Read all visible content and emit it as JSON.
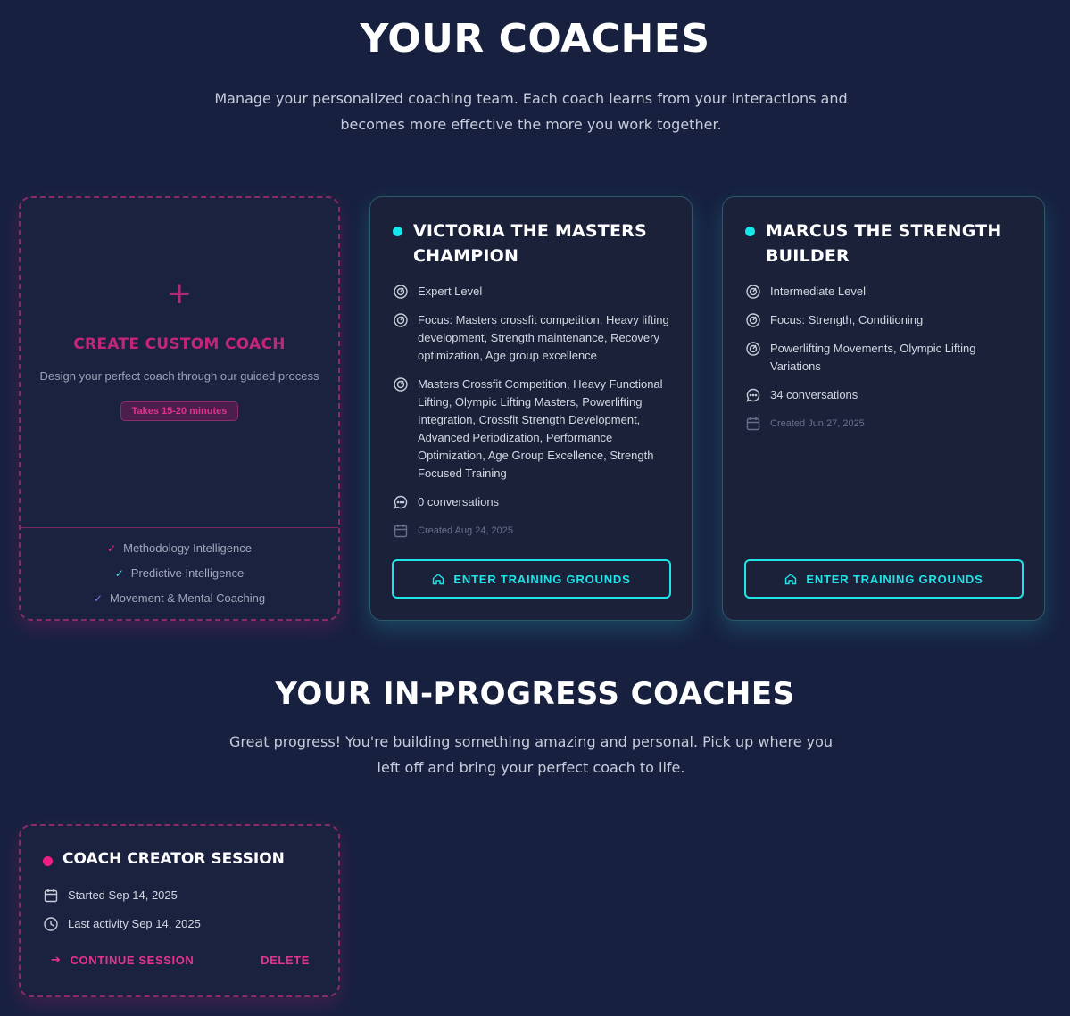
{
  "header": {
    "title": "YOUR COACHES",
    "subtitle": "Manage your personalized coaching team. Each coach learns from your interactions and becomes more effective the more you work together."
  },
  "create_card": {
    "icon": "plus-icon",
    "title": "CREATE CUSTOM COACH",
    "description": "Design your perfect coach through our guided process",
    "pill": "Takes 15-20 minutes",
    "features": [
      {
        "label": "Methodology Intelligence",
        "check_color": "#e0338f"
      },
      {
        "label": "Predictive Intelligence",
        "check_color": "#2ee6e6"
      },
      {
        "label": "Movement & Mental Coaching",
        "check_color": "#8a6cf0"
      }
    ]
  },
  "coaches": [
    {
      "name": "VICTORIA THE MASTERS CHAMPION",
      "level": "Expert Level",
      "focus": "Focus: Masters crossfit competition, Heavy lifting development, Strength maintenance, Recovery optimization, Age group excellence",
      "specialties": "Masters Crossfit Competition, Heavy Functional Lifting, Olympic Lifting Masters, Powerlifting Integration, Crossfit Strength Development, Advanced Periodization, Performance Optimization, Age Group Excellence, Strength Focused Training",
      "conversations": "0 conversations",
      "created": "Created Aug 24, 2025",
      "button": "ENTER TRAINING GROUNDS"
    },
    {
      "name": "MARCUS THE STRENGTH BUILDER",
      "level": "Intermediate Level",
      "focus": "Focus: Strength, Conditioning",
      "specialties": "Powerlifting Movements, Olympic Lifting Variations",
      "conversations": "34 conversations",
      "created": "Created Jun 27, 2025",
      "button": "ENTER TRAINING GROUNDS"
    }
  ],
  "in_progress": {
    "title": "YOUR IN-PROGRESS COACHES",
    "subtitle": "Great progress! You're building something amazing and personal. Pick up where you left off and bring your perfect coach to life.",
    "session": {
      "title": "COACH CREATOR SESSION",
      "started": "Started Sep 14, 2025",
      "last_activity": "Last activity Sep 14, 2025",
      "continue_label": "CONTINUE SESSION",
      "delete_label": "DELETE"
    }
  },
  "colors": {
    "accent_cyan": "#1fe4e8",
    "accent_pink": "#e6338f",
    "background": "#17213f"
  }
}
